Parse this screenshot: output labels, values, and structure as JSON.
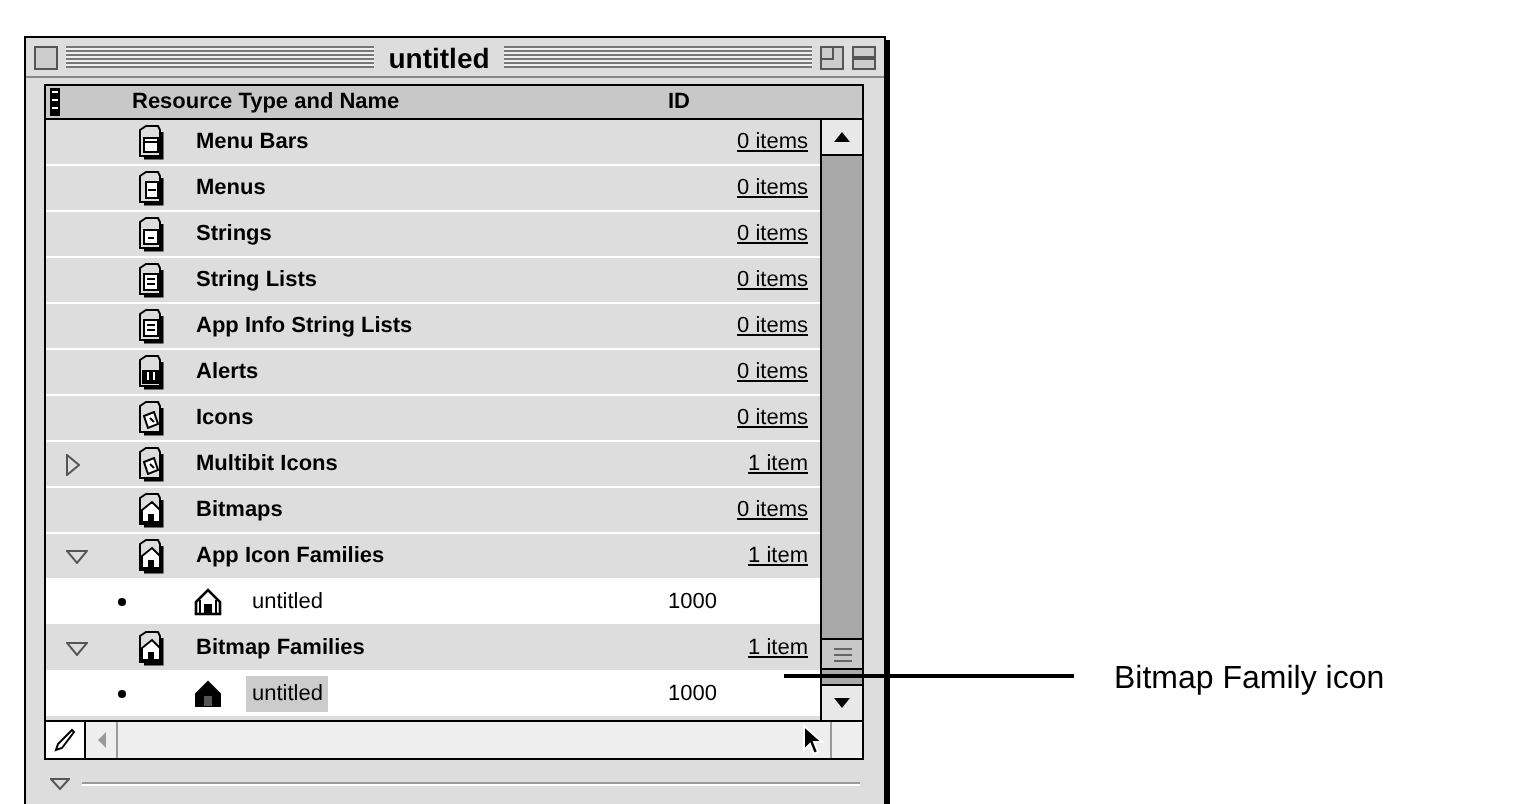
{
  "window": {
    "title": "untitled"
  },
  "table": {
    "columns": [
      "Resource Type and Name",
      "ID"
    ],
    "rows": [
      {
        "kind": "type",
        "name": "Menu Bars",
        "id": "0 items",
        "selected": false
      },
      {
        "kind": "type",
        "name": "Menus",
        "id": "0 items",
        "selected": false
      },
      {
        "kind": "type",
        "name": "Strings",
        "id": "0 items",
        "selected": false
      },
      {
        "kind": "type",
        "name": "String Lists",
        "id": "0 items",
        "selected": false
      },
      {
        "kind": "type",
        "name": "App Info String Lists",
        "id": "0 items",
        "selected": false
      },
      {
        "kind": "type",
        "name": "Alerts",
        "id": "0 items",
        "selected": false
      },
      {
        "kind": "type",
        "name": "Icons",
        "id": "0 items",
        "selected": false
      },
      {
        "kind": "type",
        "name": "Multibit Icons",
        "id": "1 item",
        "selected": false,
        "expanded": false
      },
      {
        "kind": "type",
        "name": "Bitmaps",
        "id": "0 items",
        "selected": false
      },
      {
        "kind": "type",
        "name": "App Icon Families",
        "id": "1 item",
        "selected": false,
        "expanded": true
      },
      {
        "kind": "resource",
        "name": "untitled",
        "id": "1000",
        "selected": false
      },
      {
        "kind": "type",
        "name": "Bitmap Families",
        "id": "1 item",
        "selected": false,
        "expanded": true
      },
      {
        "kind": "resource",
        "name": "untitled",
        "id": "1000",
        "selected": true
      }
    ]
  },
  "callout": {
    "label": "Bitmap Family icon"
  }
}
